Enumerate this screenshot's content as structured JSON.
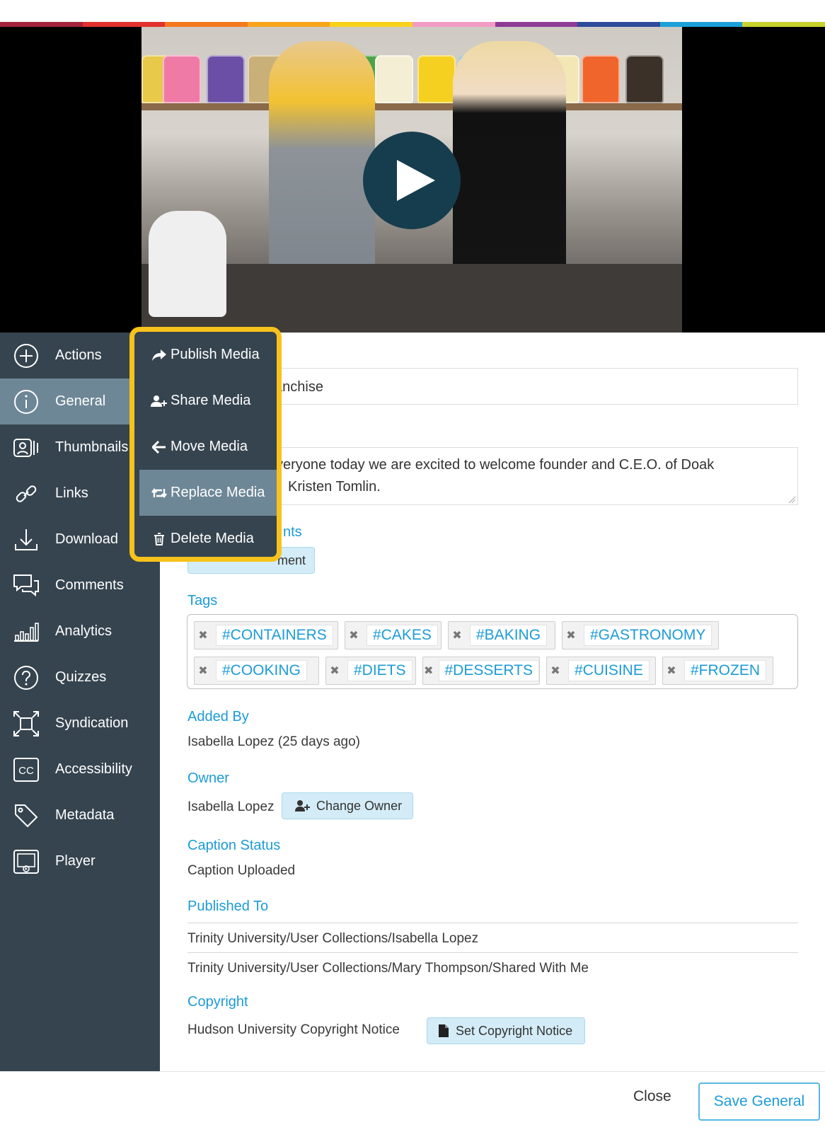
{
  "color_strip": [
    "#a4233c",
    "#e0312c",
    "#f5781e",
    "#f8a51c",
    "#f7d21a",
    "#f29bc4",
    "#8d3b96",
    "#2e4a9a",
    "#1d9fd9",
    "#c8d22c"
  ],
  "video": {
    "play_icon": "play-icon"
  },
  "sidebar": {
    "items": [
      {
        "label": "Actions",
        "icon": "plus-circle-icon"
      },
      {
        "label": "General",
        "icon": "info-circle-icon"
      },
      {
        "label": "Thumbnails",
        "icon": "thumbnails-icon"
      },
      {
        "label": "Links",
        "icon": "link-icon"
      },
      {
        "label": "Download",
        "icon": "download-icon"
      },
      {
        "label": "Comments",
        "icon": "comments-icon"
      },
      {
        "label": "Analytics",
        "icon": "analytics-icon"
      },
      {
        "label": "Quizzes",
        "icon": "question-circle-icon"
      },
      {
        "label": "Syndication",
        "icon": "syndication-icon"
      },
      {
        "label": "Accessibility",
        "icon": "cc-icon"
      },
      {
        "label": "Metadata",
        "icon": "tag-icon"
      },
      {
        "label": "Player",
        "icon": "player-icon"
      }
    ]
  },
  "actions_menu": {
    "items": [
      {
        "label": "Publish Media",
        "icon": "share-arrow-icon"
      },
      {
        "label": "Share Media",
        "icon": "user-plus-icon"
      },
      {
        "label": "Move Media",
        "icon": "arrow-left-icon"
      },
      {
        "label": "Replace Media",
        "icon": "retweet-icon"
      },
      {
        "label": "Delete Media",
        "icon": "trash-icon"
      }
    ]
  },
  "general": {
    "title_visible": "anchise",
    "description_line1": "veryone today we are excited to welcome founder and C.E.O. of Doak",
    "description_line2": "Kristen Tomlin.",
    "documents_label_visible": "nts",
    "add_document_visible": "ment",
    "tags_label": "Tags",
    "tags": [
      "#CONTAINERS",
      "#CAKES",
      "#BAKING",
      "#GASTRONOMY",
      "#COOKING",
      "#DIETS",
      "#DESSERTS",
      "#CUISINE",
      "#FROZEN"
    ],
    "added_by_label": "Added By",
    "added_by_value": "Isabella Lopez (25 days ago)",
    "owner_label": "Owner",
    "owner_value": "Isabella Lopez",
    "change_owner_label": "Change Owner",
    "caption_status_label": "Caption Status",
    "caption_status_value": "Caption Uploaded",
    "published_to_label": "Published To",
    "published_to": [
      "Trinity University/User Collections/Isabella Lopez",
      "Trinity University/User Collections/Mary Thompson/Shared With Me"
    ],
    "copyright_label": "Copyright",
    "copyright_value": "Hudson University Copyright Notice",
    "set_copyright_label": "Set Copyright Notice"
  },
  "footer": {
    "close_label": "Close",
    "save_label": "Save General"
  }
}
